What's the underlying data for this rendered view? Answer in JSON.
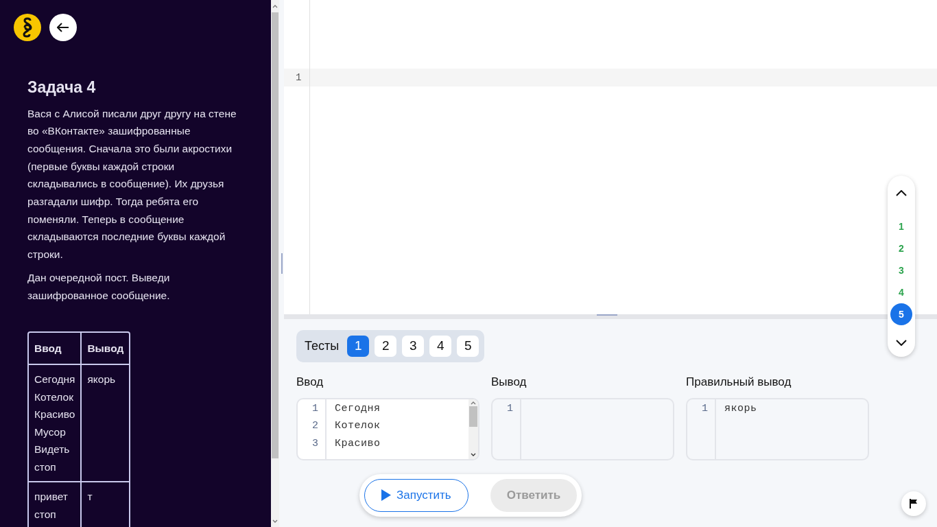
{
  "sidebar": {
    "title": "Задача 4",
    "paragraphs": [
      "Вася с Алисой писали друг другу на стене во «ВКонтакте» зашифрованные сообщения. Сначала это были акростихи (первые буквы каждой строки складывались в сообщение). Их друзья разгадали шифр. Тогда ребята его поменяли. Теперь в сообщение складываются последние буквы каждой строки.",
      "Дан очередной пост. Выведи зашифрованное сообщение."
    ],
    "table": {
      "columns": [
        "Ввод",
        "Вывод"
      ],
      "rows": [
        {
          "input": [
            "Сегодня",
            "Котелок",
            "Красиво",
            "Мусор",
            "Видеть",
            "стоп"
          ],
          "output": [
            "якорь"
          ]
        },
        {
          "input": [
            "привет",
            "стоп"
          ],
          "output": [
            "т"
          ]
        }
      ]
    }
  },
  "editor": {
    "line_numbers": [
      "1"
    ]
  },
  "task_nav": [
    {
      "label": "1",
      "selected": false,
      "solved": true
    },
    {
      "label": "2",
      "selected": false,
      "solved": true
    },
    {
      "label": "3",
      "selected": false,
      "solved": true
    },
    {
      "label": "4",
      "selected": false,
      "solved": true
    },
    {
      "label": "5",
      "selected": true,
      "solved": false
    }
  ],
  "tests": {
    "label": "Тесты",
    "tabs": [
      {
        "label": "1",
        "selected": true
      },
      {
        "label": "2",
        "selected": false
      },
      {
        "label": "3",
        "selected": false
      },
      {
        "label": "4",
        "selected": false
      },
      {
        "label": "5",
        "selected": false
      }
    ]
  },
  "panes": [
    {
      "kind": "input",
      "title": "Ввод",
      "lines": [
        {
          "n": "1",
          "text": "Сегодня"
        },
        {
          "n": "2",
          "text": "Котелок"
        },
        {
          "n": "3",
          "text": "Красиво"
        }
      ]
    },
    {
      "kind": "output",
      "title": "Вывод",
      "lines": [
        {
          "n": "1"
        }
      ]
    },
    {
      "kind": "output",
      "title": "Правильный вывод",
      "lines": [
        {
          "n": "1",
          "text": "якорь"
        }
      ]
    }
  ],
  "actions": {
    "run": "Запустить",
    "answer": "Ответить",
    "answer_disabled": true
  }
}
